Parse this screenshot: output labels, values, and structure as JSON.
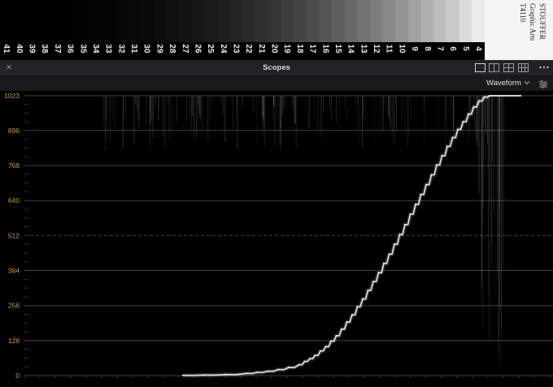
{
  "step_wedge": {
    "numbers": [
      "41",
      "40",
      "39",
      "38",
      "37",
      "36",
      "35",
      "34",
      "33",
      "32",
      "31",
      "30",
      "29",
      "28",
      "27",
      "26",
      "25",
      "24",
      "23",
      "22",
      "21",
      "20",
      "19",
      "18",
      "17",
      "16",
      "15",
      "14",
      "13",
      "12",
      "11",
      "10",
      "9",
      "8",
      "7",
      "6",
      "5",
      "4"
    ],
    "brand_lines": [
      "STOUFFER",
      "Graphic Arts",
      "T4110"
    ]
  },
  "panel": {
    "close_glyph": "×",
    "title": "Scopes",
    "layout_icons": [
      "single-view-icon",
      "dual-view-icon",
      "quad-view-icon",
      "grid-view-icon"
    ],
    "more_icon": "more-options-icon",
    "mode_value": "Waveform",
    "settings_icon": "scope-settings-icon"
  },
  "chart_data": {
    "type": "line",
    "title": "",
    "xlabel": "",
    "ylabel": "",
    "ylim": [
      0,
      1023
    ],
    "yticks": [
      "0",
      "128",
      "256",
      "384",
      "512",
      "640",
      "768",
      "896",
      "1023"
    ],
    "ytick_values": [
      0,
      128,
      256,
      384,
      512,
      640,
      768,
      896,
      1023
    ],
    "grid": true,
    "dashed_gridline_value": 512,
    "series": [
      {
        "x": [
          0.3,
          0.34,
          0.38,
          0.42,
          0.44,
          0.46,
          0.48,
          0.5,
          0.52,
          0.53,
          0.54,
          0.55,
          0.56,
          0.57,
          0.58,
          0.59,
          0.6,
          0.61,
          0.62,
          0.63,
          0.64,
          0.65,
          0.66,
          0.67,
          0.68,
          0.69,
          0.7,
          0.71,
          0.72,
          0.73,
          0.74,
          0.75,
          0.76,
          0.77,
          0.78,
          0.79,
          0.8,
          0.81,
          0.82,
          0.83,
          0.84,
          0.85,
          0.86,
          0.87,
          0.88
        ],
        "values": [
          1,
          2,
          4,
          8,
          12,
          16,
          22,
          30,
          40,
          52,
          62,
          74,
          90,
          106,
          126,
          146,
          170,
          196,
          222,
          252,
          280,
          312,
          344,
          376,
          410,
          444,
          480,
          516,
          552,
          590,
          626,
          662,
          698,
          734,
          770,
          804,
          838,
          870,
          900,
          928,
          956,
          982,
          1004,
          1018,
          1023
        ]
      }
    ],
    "colors": {
      "trace": "#e6e6e6",
      "grid": "#4a3e28",
      "tick_text": "#bf9a55"
    }
  }
}
